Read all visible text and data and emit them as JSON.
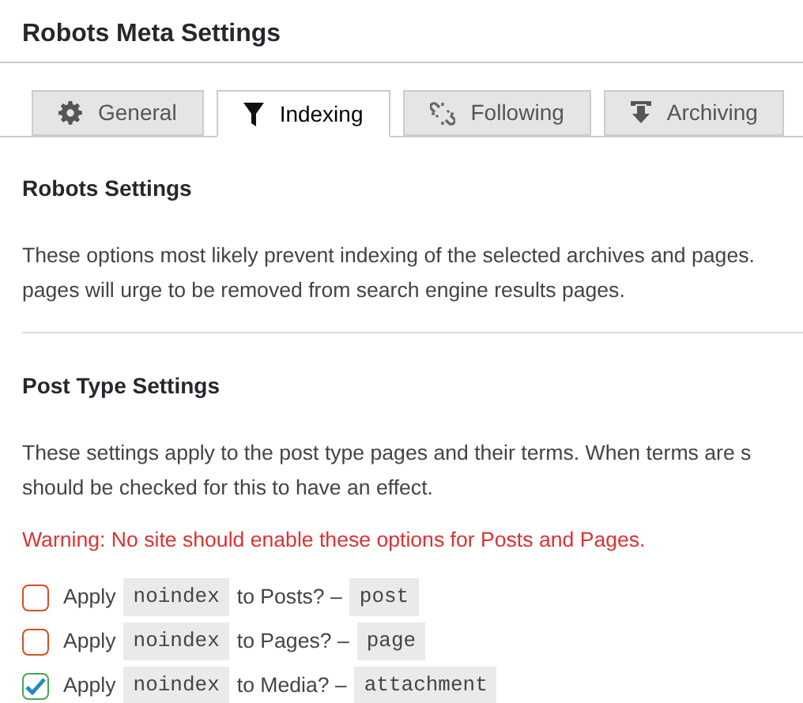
{
  "window": {
    "title": "Robots Meta Settings"
  },
  "tabs": [
    {
      "label": "General",
      "selected": false
    },
    {
      "label": "Indexing",
      "selected": true
    },
    {
      "label": "Following",
      "selected": false
    },
    {
      "label": "Archiving",
      "selected": false
    }
  ],
  "sections": [
    {
      "heading": "Robots Settings",
      "paragraph_lines": [
        "These options most likely prevent indexing of the selected archives and pages.",
        "pages will urge to be removed from search engine results pages."
      ]
    },
    {
      "heading": "Post Type Settings",
      "paragraph_lines": [
        "These settings apply to the post type pages and their terms. When terms are s",
        "should be checked for this to have an effect."
      ],
      "warning": "Warning: No site should enable these options for Posts and Pages.",
      "options": [
        {
          "prefix": "Apply",
          "code": "noindex",
          "middle": "to Posts? –",
          "slug": "post",
          "checked": false,
          "color": "#d54e21"
        },
        {
          "prefix": "Apply",
          "code": "noindex",
          "middle": "to Pages? –",
          "slug": "page",
          "checked": false,
          "color": "#d54e21"
        },
        {
          "prefix": "Apply",
          "code": "noindex",
          "middle": "to Media? –",
          "slug": "attachment",
          "checked": true,
          "color": "#46a94f"
        }
      ]
    }
  ]
}
